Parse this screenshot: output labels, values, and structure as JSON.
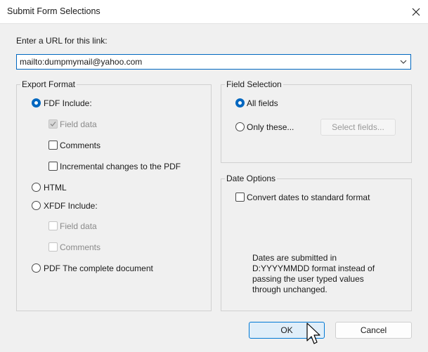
{
  "window": {
    "title": "Submit Form Selections",
    "close_icon": "close-icon"
  },
  "url": {
    "label": "Enter a URL for this link:",
    "value": "mailto:dumpmymail@yahoo.com",
    "dropdown_icon": "chevron-down-icon"
  },
  "export_format": {
    "legend": "Export Format",
    "fdf": {
      "label": "FDF  Include:",
      "selected": true
    },
    "fdf_field_data": {
      "label": "Field data",
      "checked": true,
      "enabled": false
    },
    "fdf_comments": {
      "label": "Comments",
      "checked": false,
      "enabled": true
    },
    "fdf_incremental": {
      "label": "Incremental changes to the PDF",
      "checked": false,
      "enabled": true
    },
    "html": {
      "label": "HTML",
      "selected": false
    },
    "xfdf": {
      "label": "XFDF  Include:",
      "selected": false
    },
    "xfdf_field_data": {
      "label": "Field data",
      "checked": false,
      "enabled": false
    },
    "xfdf_comments": {
      "label": "Comments",
      "checked": false,
      "enabled": false
    },
    "pdf": {
      "label": "PDF  The complete document",
      "selected": false
    }
  },
  "field_selection": {
    "legend": "Field Selection",
    "all_fields": {
      "label": "All fields",
      "selected": true
    },
    "only_these": {
      "label": "Only these...",
      "selected": false
    },
    "select_fields_button": "Select fields..."
  },
  "date_options": {
    "legend": "Date Options",
    "convert_dates": {
      "label": "Convert dates to standard format",
      "checked": false
    },
    "note_lines": [
      "Dates are submitted in",
      "D:YYYYMMDD format instead of",
      "passing the user typed values",
      "through unchanged."
    ]
  },
  "buttons": {
    "ok": "OK",
    "cancel": "Cancel"
  },
  "colors": {
    "accent": "#0067c0",
    "background": "#f0f0f0"
  }
}
